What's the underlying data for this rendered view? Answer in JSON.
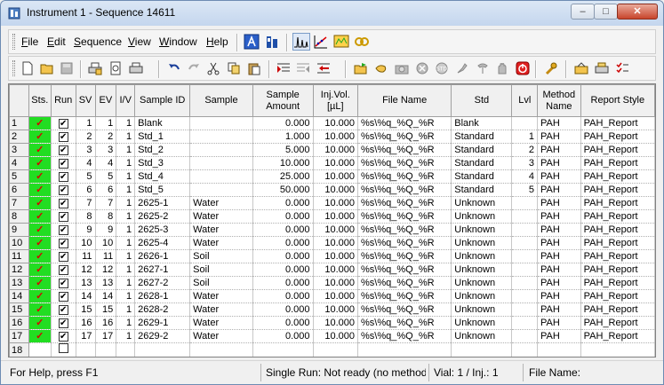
{
  "window": {
    "title": "Instrument 1 - Sequence 14611",
    "minimize": "–",
    "maximize": "□",
    "close": "✕"
  },
  "menu": [
    {
      "label": "File",
      "accel": "F",
      "rest": "ile"
    },
    {
      "label": "Edit",
      "accel": "E",
      "rest": "dit"
    },
    {
      "label": "Sequence",
      "accel": "S",
      "rest": "equence"
    },
    {
      "label": "View",
      "accel": "V",
      "rest": "iew"
    },
    {
      "label": "Window",
      "accel": "W",
      "rest": "indow"
    },
    {
      "label": "Help",
      "accel": "H",
      "rest": "elp"
    }
  ],
  "grid": {
    "columns": [
      "",
      "Sts.",
      "Run",
      "SV",
      "EV",
      "I/V",
      "Sample ID",
      "Sample",
      "Sample Amount",
      "Inj.Vol. [µL]",
      "File Name",
      "Std",
      "Lvl",
      "Method Name",
      "Report Style"
    ],
    "rows": [
      {
        "n": "1",
        "sv": "1",
        "ev": "1",
        "iv": "1",
        "id": "Blank",
        "sample": "",
        "amount": "0.000",
        "vol": "10.000",
        "file": "%s\\%q_%Q_%R",
        "std": "Blank",
        "lvl": "",
        "method": "PAH",
        "report": "PAH_Report"
      },
      {
        "n": "2",
        "sv": "2",
        "ev": "2",
        "iv": "1",
        "id": "Std_1",
        "sample": "",
        "amount": "1.000",
        "vol": "10.000",
        "file": "%s\\%q_%Q_%R",
        "std": "Standard",
        "lvl": "1",
        "method": "PAH",
        "report": "PAH_Report"
      },
      {
        "n": "3",
        "sv": "3",
        "ev": "3",
        "iv": "1",
        "id": "Std_2",
        "sample": "",
        "amount": "5.000",
        "vol": "10.000",
        "file": "%s\\%q_%Q_%R",
        "std": "Standard",
        "lvl": "2",
        "method": "PAH",
        "report": "PAH_Report"
      },
      {
        "n": "4",
        "sv": "4",
        "ev": "4",
        "iv": "1",
        "id": "Std_3",
        "sample": "",
        "amount": "10.000",
        "vol": "10.000",
        "file": "%s\\%q_%Q_%R",
        "std": "Standard",
        "lvl": "3",
        "method": "PAH",
        "report": "PAH_Report"
      },
      {
        "n": "5",
        "sv": "5",
        "ev": "5",
        "iv": "1",
        "id": "Std_4",
        "sample": "",
        "amount": "25.000",
        "vol": "10.000",
        "file": "%s\\%q_%Q_%R",
        "std": "Standard",
        "lvl": "4",
        "method": "PAH",
        "report": "PAH_Report"
      },
      {
        "n": "6",
        "sv": "6",
        "ev": "6",
        "iv": "1",
        "id": "Std_5",
        "sample": "",
        "amount": "50.000",
        "vol": "10.000",
        "file": "%s\\%q_%Q_%R",
        "std": "Standard",
        "lvl": "5",
        "method": "PAH",
        "report": "PAH_Report"
      },
      {
        "n": "7",
        "sv": "7",
        "ev": "7",
        "iv": "1",
        "id": "2625-1",
        "sample": "Water",
        "amount": "0.000",
        "vol": "10.000",
        "file": "%s\\%q_%Q_%R",
        "std": "Unknown",
        "lvl": "",
        "method": "PAH",
        "report": "PAH_Report"
      },
      {
        "n": "8",
        "sv": "8",
        "ev": "8",
        "iv": "1",
        "id": "2625-2",
        "sample": "Water",
        "amount": "0.000",
        "vol": "10.000",
        "file": "%s\\%q_%Q_%R",
        "std": "Unknown",
        "lvl": "",
        "method": "PAH",
        "report": "PAH_Report"
      },
      {
        "n": "9",
        "sv": "9",
        "ev": "9",
        "iv": "1",
        "id": "2625-3",
        "sample": "Water",
        "amount": "0.000",
        "vol": "10.000",
        "file": "%s\\%q_%Q_%R",
        "std": "Unknown",
        "lvl": "",
        "method": "PAH",
        "report": "PAH_Report"
      },
      {
        "n": "10",
        "sv": "10",
        "ev": "10",
        "iv": "1",
        "id": "2625-4",
        "sample": "Water",
        "amount": "0.000",
        "vol": "10.000",
        "file": "%s\\%q_%Q_%R",
        "std": "Unknown",
        "lvl": "",
        "method": "PAH",
        "report": "PAH_Report"
      },
      {
        "n": "11",
        "sv": "11",
        "ev": "11",
        "iv": "1",
        "id": "2626-1",
        "sample": "Soil",
        "amount": "0.000",
        "vol": "10.000",
        "file": "%s\\%q_%Q_%R",
        "std": "Unknown",
        "lvl": "",
        "method": "PAH",
        "report": "PAH_Report"
      },
      {
        "n": "12",
        "sv": "12",
        "ev": "12",
        "iv": "1",
        "id": "2627-1",
        "sample": "Soil",
        "amount": "0.000",
        "vol": "10.000",
        "file": "%s\\%q_%Q_%R",
        "std": "Unknown",
        "lvl": "",
        "method": "PAH",
        "report": "PAH_Report"
      },
      {
        "n": "13",
        "sv": "13",
        "ev": "13",
        "iv": "1",
        "id": "2627-2",
        "sample": "Soil",
        "amount": "0.000",
        "vol": "10.000",
        "file": "%s\\%q_%Q_%R",
        "std": "Unknown",
        "lvl": "",
        "method": "PAH",
        "report": "PAH_Report"
      },
      {
        "n": "14",
        "sv": "14",
        "ev": "14",
        "iv": "1",
        "id": "2628-1",
        "sample": "Water",
        "amount": "0.000",
        "vol": "10.000",
        "file": "%s\\%q_%Q_%R",
        "std": "Unknown",
        "lvl": "",
        "method": "PAH",
        "report": "PAH_Report"
      },
      {
        "n": "15",
        "sv": "15",
        "ev": "15",
        "iv": "1",
        "id": "2628-2",
        "sample": "Water",
        "amount": "0.000",
        "vol": "10.000",
        "file": "%s\\%q_%Q_%R",
        "std": "Unknown",
        "lvl": "",
        "method": "PAH",
        "report": "PAH_Report"
      },
      {
        "n": "16",
        "sv": "16",
        "ev": "16",
        "iv": "1",
        "id": "2629-1",
        "sample": "Water",
        "amount": "0.000",
        "vol": "10.000",
        "file": "%s\\%q_%Q_%R",
        "std": "Unknown",
        "lvl": "",
        "method": "PAH",
        "report": "PAH_Report"
      },
      {
        "n": "17",
        "sv": "17",
        "ev": "17",
        "iv": "1",
        "id": "2629-2",
        "sample": "Water",
        "amount": "0.000",
        "vol": "10.000",
        "file": "%s\\%q_%Q_%R",
        "std": "Unknown",
        "lvl": "",
        "method": "PAH",
        "report": "PAH_Report"
      }
    ],
    "empty_row_number": "18",
    "status_glyph": "✓",
    "run_glyph": "✔"
  },
  "statusbar": {
    "help": "For Help, press F1",
    "run": "Single Run: Not ready (no method",
    "vial": "Vial: 1 / Inj.: 1",
    "file": "File Name:"
  },
  "colors": {
    "status_ok": "#22dd22",
    "check": "#d80000"
  }
}
